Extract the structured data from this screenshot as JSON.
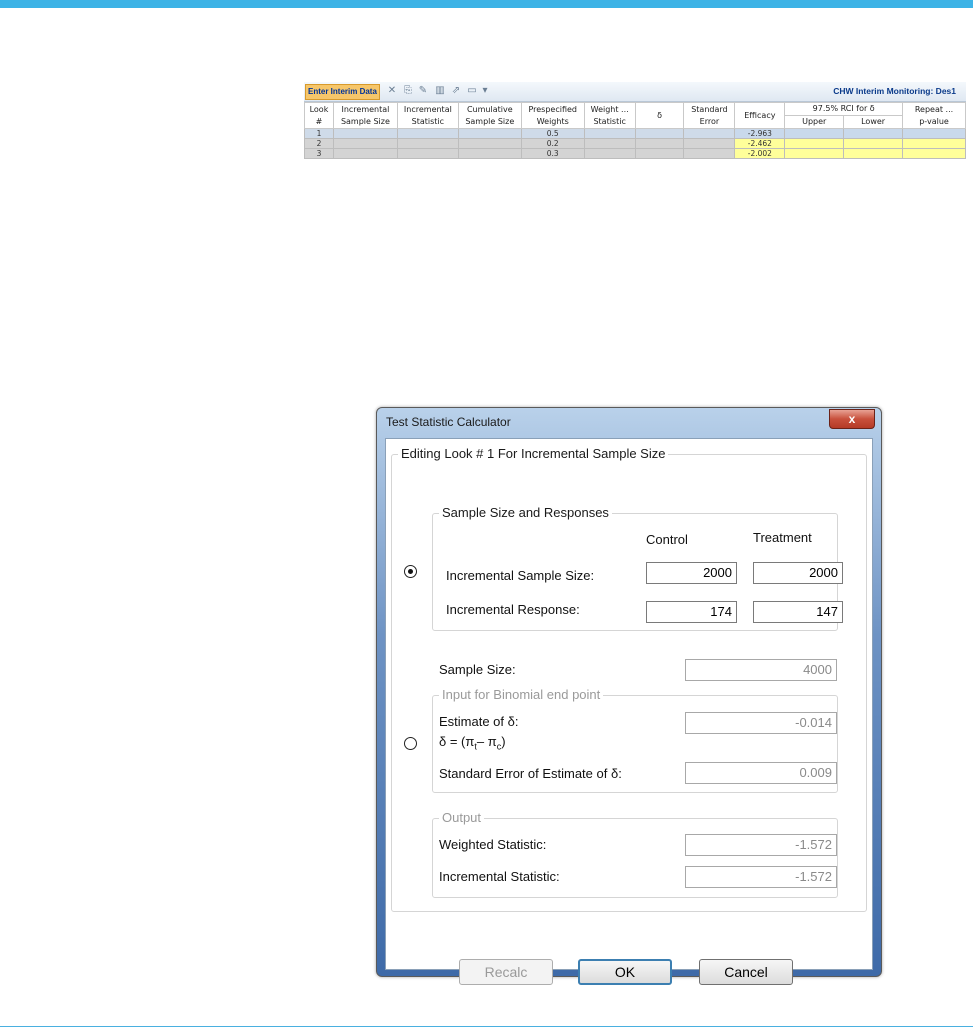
{
  "interim": {
    "enter_button": "Enter Interim Data",
    "title": "CHW Interim Monitoring: Des1",
    "columns": [
      [
        "Look",
        "#"
      ],
      [
        "Incremental",
        "Sample Size"
      ],
      [
        "Incremental",
        "Statistic"
      ],
      [
        "Cumulative",
        "Sample Size"
      ],
      [
        "Prespecified",
        "Weights"
      ],
      [
        "Weight ...",
        "Statistic"
      ],
      [
        "δ"
      ],
      [
        "Standard",
        "Error"
      ],
      [
        "Efficacy"
      ],
      [
        "97.5% RCI for δ"
      ],
      [
        "Repeat ...",
        "p-value"
      ]
    ],
    "rci_sub": [
      "Upper",
      "Lower"
    ],
    "rows": [
      {
        "look": "1",
        "weight": "0.5",
        "efficacy": "-2.963"
      },
      {
        "look": "2",
        "weight": "0.2",
        "efficacy": "-2.462"
      },
      {
        "look": "3",
        "weight": "0.3",
        "efficacy": "-2.002"
      }
    ]
  },
  "dialog": {
    "title": "Test Statistic Calculator",
    "close_label": "x",
    "group_title": "Editing Look # 1 For Incremental Sample Size",
    "ssr": {
      "legend": "Sample Size and Responses",
      "col_control": "Control",
      "col_treatment": "Treatment",
      "inc_ss_label": "Incremental Sample Size:",
      "inc_ss_control": "2000",
      "inc_ss_treatment": "2000",
      "inc_resp_label": "Incremental Response:",
      "inc_resp_control": "174",
      "inc_resp_treatment": "147"
    },
    "sample_size_label": "Sample Size:",
    "sample_size_value": "4000",
    "binomial": {
      "legend": "Input for Binomial end point",
      "estimate_label": "Estimate of δ:",
      "estimate_value": "-0.014",
      "formula_prefix": "δ = (π",
      "formula_sub_t": "t",
      "formula_minus": "– π",
      "formula_sub_c": "c",
      "formula_suffix": ")",
      "se_label": "Standard Error of Estimate of δ:",
      "se_value": "0.009"
    },
    "output": {
      "legend": "Output",
      "weighted_label": "Weighted Statistic:",
      "weighted_value": "-1.572",
      "incremental_label": "Incremental Statistic:",
      "incremental_value": "-1.572"
    },
    "buttons": {
      "recalc": "Recalc",
      "ok": "OK",
      "cancel": "Cancel"
    }
  }
}
